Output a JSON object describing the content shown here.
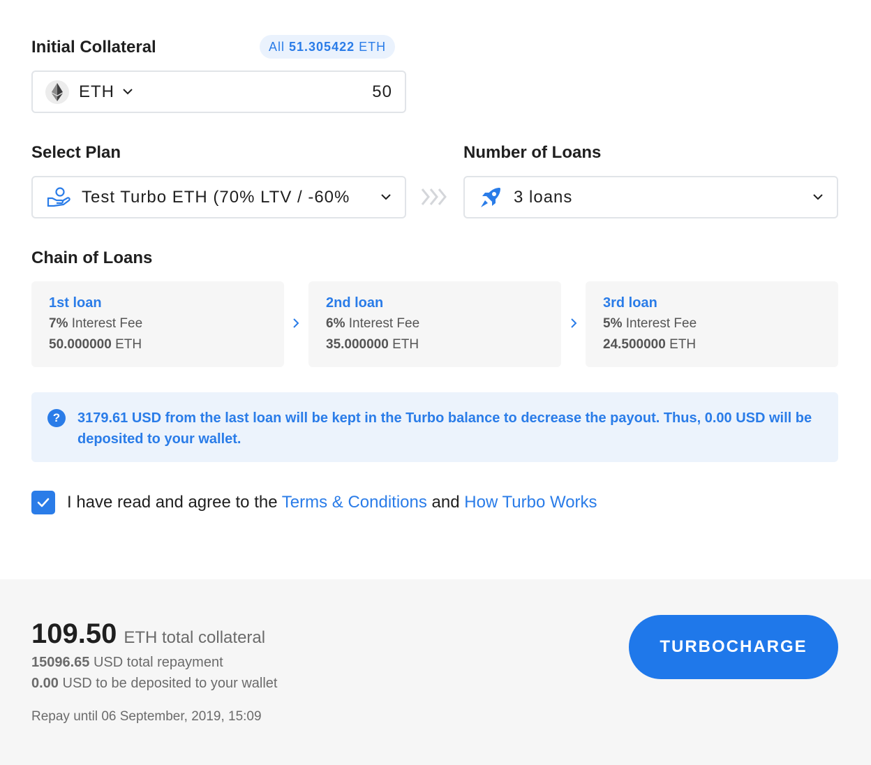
{
  "collateral": {
    "label": "Initial Collateral",
    "all_prefix": "All",
    "all_amount": "51.305422",
    "all_unit": "ETH",
    "currency": "ETH",
    "amount": "50"
  },
  "plan": {
    "label": "Select Plan",
    "selected": "Test Turbo ETH (70% LTV / -60%"
  },
  "loans": {
    "label": "Number of Loans",
    "selected": "3 loans"
  },
  "chain": {
    "label": "Chain of Loans",
    "items": [
      {
        "title": "1st loan",
        "fee": "7%",
        "fee_label": "Interest Fee",
        "amount": "50.000000",
        "unit": "ETH"
      },
      {
        "title": "2nd loan",
        "fee": "6%",
        "fee_label": "Interest Fee",
        "amount": "35.000000",
        "unit": "ETH"
      },
      {
        "title": "3rd loan",
        "fee": "5%",
        "fee_label": "Interest Fee",
        "amount": "24.500000",
        "unit": "ETH"
      }
    ]
  },
  "notice": {
    "icon": "?",
    "text": "3179.61 USD from the last loan will be kept in the Turbo balance to decrease the payout. Thus, 0.00 USD will be deposited to your wallet."
  },
  "agreement": {
    "checked": true,
    "prefix": "I have read and agree to the",
    "terms_link": "Terms & Conditions",
    "middle": "and",
    "how_link": "How Turbo Works"
  },
  "summary": {
    "total_value": "109.50",
    "total_label": "ETH total collateral",
    "repayment_value": "15096.65",
    "repayment_label": "USD total repayment",
    "deposit_value": "0.00",
    "deposit_label": "USD to be deposited to your wallet",
    "repay_until": "Repay until 06 September, 2019, 15:09",
    "button_label": "TURBOCHARGE"
  },
  "colors": {
    "accent": "#2a7ce8",
    "button": "#1f78ea",
    "notice_bg": "#ecf3fc",
    "card_bg": "#f6f6f6"
  }
}
